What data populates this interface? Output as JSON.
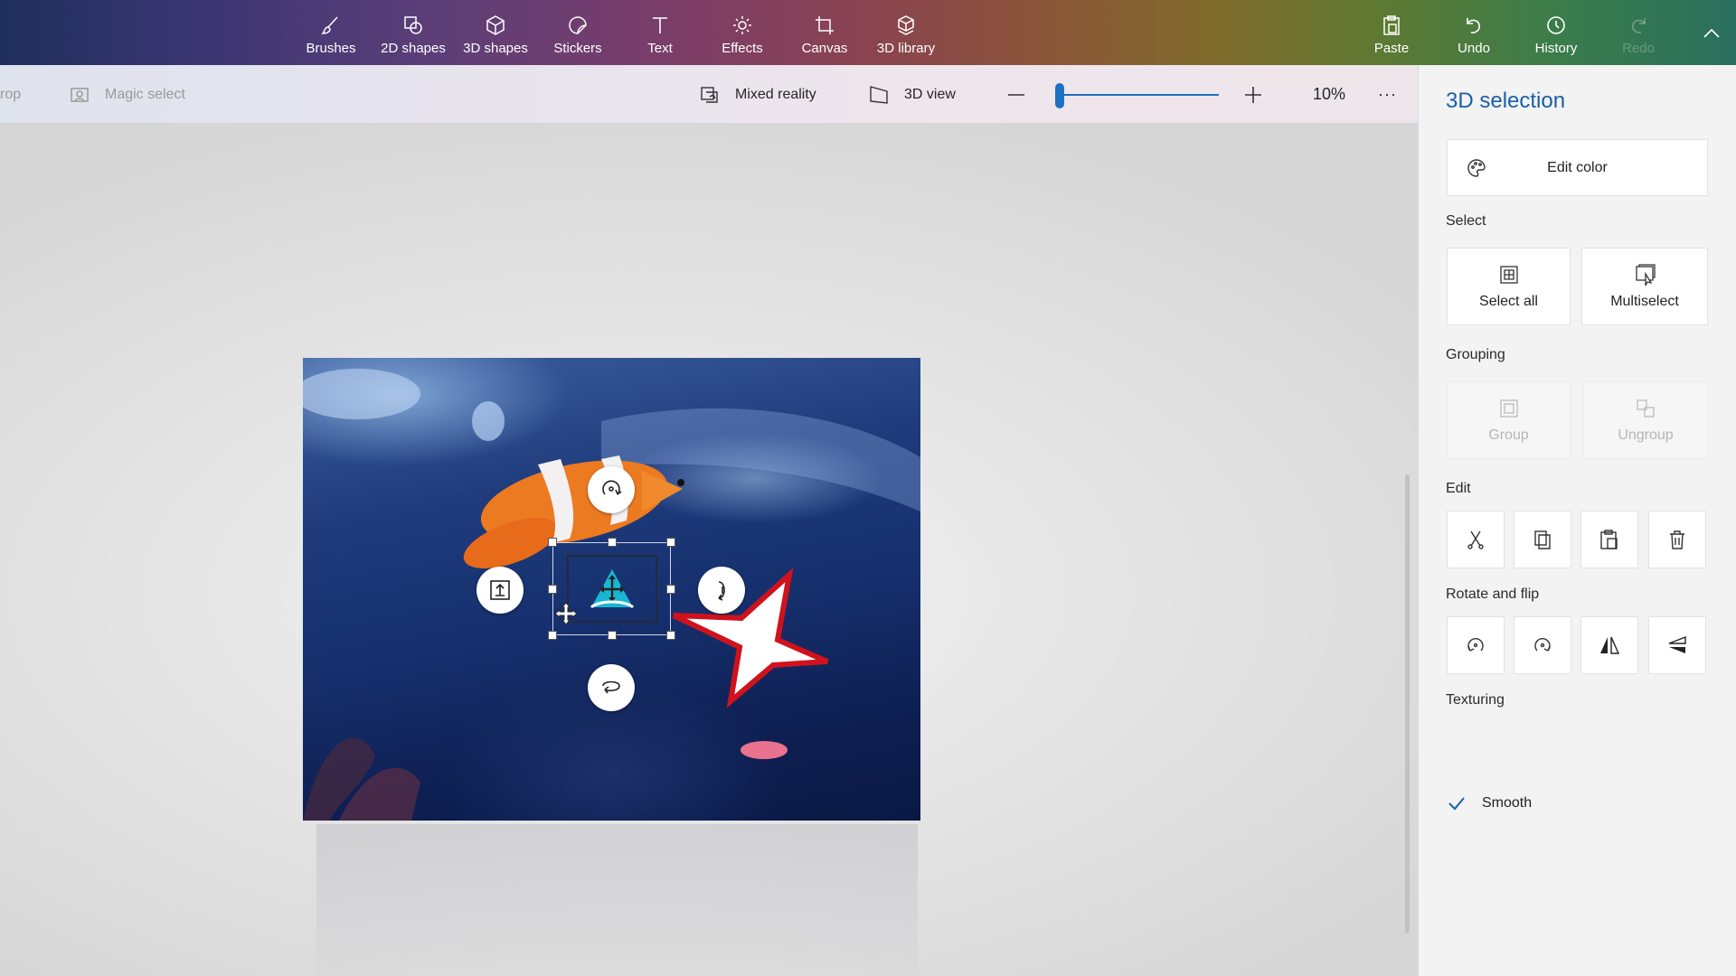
{
  "ribbon": {
    "items": [
      {
        "label": "Brushes",
        "icon": "brush-icon"
      },
      {
        "label": "2D shapes",
        "icon": "2d-shapes-icon"
      },
      {
        "label": "3D shapes",
        "icon": "3d-shapes-icon"
      },
      {
        "label": "Stickers",
        "icon": "stickers-icon"
      },
      {
        "label": "Text",
        "icon": "text-icon"
      },
      {
        "label": "Effects",
        "icon": "effects-icon"
      },
      {
        "label": "Canvas",
        "icon": "canvas-icon"
      },
      {
        "label": "3D library",
        "icon": "3d-library-icon"
      }
    ],
    "right_items": [
      {
        "label": "Paste",
        "icon": "paste-icon"
      },
      {
        "label": "Undo",
        "icon": "undo-icon"
      },
      {
        "label": "History",
        "icon": "history-icon"
      },
      {
        "label": "Redo",
        "icon": "redo-icon"
      }
    ]
  },
  "toolbar": {
    "crop_partial": "rop",
    "magic_select": "Magic select",
    "mixed_reality": "Mixed reality",
    "view_3d": "3D view",
    "zoom_percent": "10%",
    "zoom_level": 0.02,
    "more": "···"
  },
  "panel": {
    "title": "3D selection",
    "edit_color": "Edit color",
    "select_section": "Select",
    "select_all": "Select all",
    "multiselect": "Multiselect",
    "grouping_section": "Grouping",
    "group": "Group",
    "ungroup": "Ungroup",
    "edit_section": "Edit",
    "edit_buttons": [
      "cut-icon",
      "copy-icon",
      "paste-icon",
      "delete-icon"
    ],
    "rotate_section": "Rotate and flip",
    "rotate_buttons": [
      "rotate-left-icon",
      "rotate-right-icon",
      "flip-horizontal-icon",
      "flip-vertical-icon"
    ],
    "texturing_section": "Texturing",
    "smooth_label": "Smooth",
    "smooth_checked": true
  },
  "colors": {
    "accent": "#1a5fa8",
    "slider": "#1f6fc2"
  }
}
